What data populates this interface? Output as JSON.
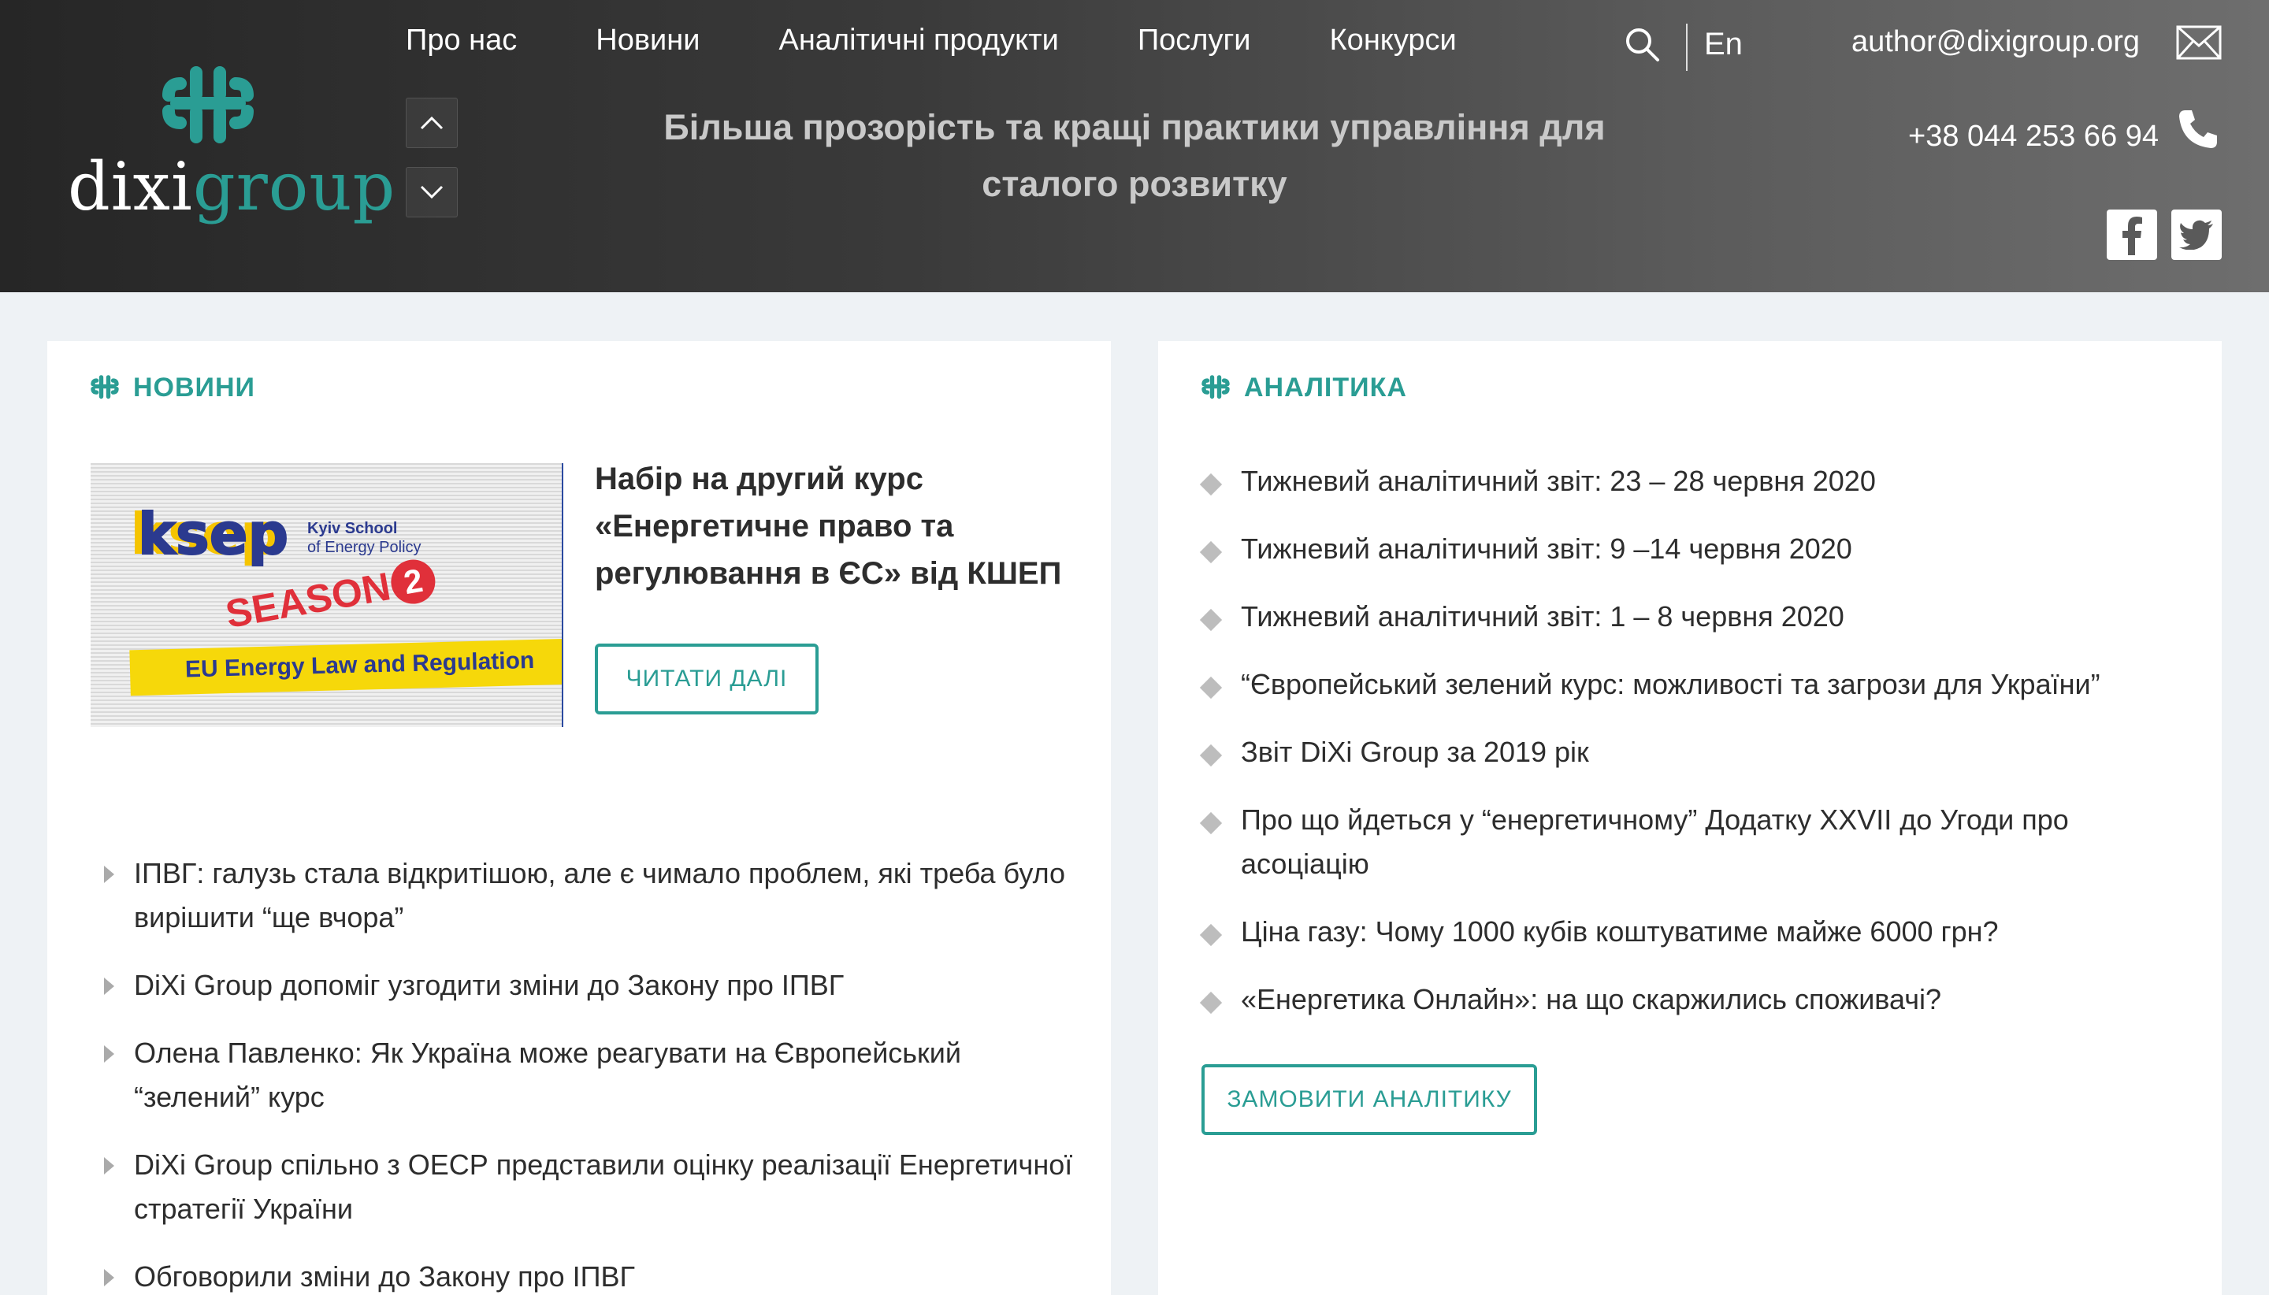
{
  "header": {
    "nav": [
      "Про нас",
      "Новини",
      "Аналітичні продукти",
      "Послуги",
      "Конкурси"
    ],
    "tagline_line1": "Більша прозорість та кращі практики управління для",
    "tagline_line2": "сталого розвитку",
    "lang": "En",
    "email": "author@dixigroup.org",
    "phone": "+38 044 253 66 94",
    "logo": {
      "part1": "dixi",
      "part2": "group"
    },
    "icons": {
      "search": "search-icon",
      "mail": "mail-icon",
      "phone": "phone-icon",
      "facebook": "facebook-icon",
      "twitter": "twitter-icon"
    }
  },
  "news": {
    "title": "НОВИНИ",
    "feature": {
      "title": "Набір на другий курс «Енергетичне право та регулювання в ЄС» від КШЕП",
      "button": "ЧИТАТИ ДАЛІ",
      "image_text": {
        "logo": "ksep",
        "school": "Kyiv School",
        "school2": "of Energy Policy",
        "season": "SEASON",
        "season_num": "2",
        "course": "EU Energy Law and Regulation"
      }
    },
    "items": [
      "ІПВГ: галузь стала відкритішою, але є чимало проблем, які треба було вирішити “ще вчора”",
      "DiXi Group допоміг узгодити зміни до Закону про ІПВГ",
      "Олена Павленко: Як Україна може реагувати на Європейський “зелений” курс",
      "DiXi Group спільно з ОЕСР представили оцінку реалізації Енергетичної стратегії України",
      "Обговорили зміни до Закону про ІПВГ"
    ]
  },
  "analytics": {
    "title": "АНАЛІТИКА",
    "items": [
      "Тижневий аналітичний звіт: 23 – 28 червня 2020",
      "Тижневий аналітичний звіт: 9 –14 червня 2020",
      "Тижневий аналітичний звіт: 1 – 8 червня 2020",
      "“Європейський зелений курс: можливості та загрози для України”",
      "Звіт DiXi Group за 2019 рік",
      "Про що йдеться у “енергетичному” Додатку XXVII до Угоди про асоціацію",
      "Ціна газу: Чому 1000 кубів коштуватиме майже 6000 грн?",
      "«Енергетика Онлайн»: на що скаржились споживачі?"
    ],
    "button": "ЗАМОВИТИ АНАЛІТИКУ"
  },
  "colors": {
    "accent": "#2a9d94",
    "header_dark": "#262626",
    "text": "#2d2d2d"
  }
}
